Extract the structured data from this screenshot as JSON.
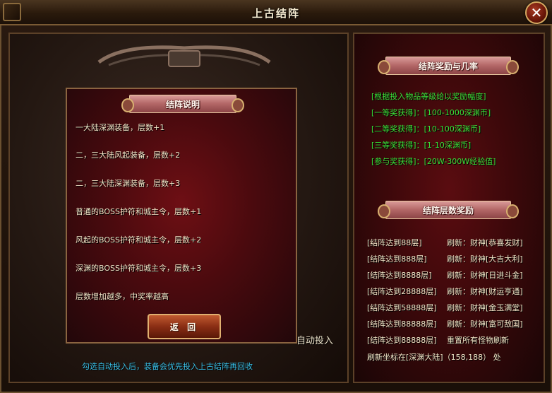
{
  "window": {
    "title": "上古结阵"
  },
  "left": {
    "explain_title": "结阵说明",
    "rules": [
      "一大陆深渊装备，层数+1",
      "二，三大陆风起装备，层数+2",
      "二，三大陆深渊装备，层数+3",
      "普通的BOSS护符和城主令，层数+1",
      "风起的BOSS护符和城主令，层数+2",
      "深渊的BOSS护符和城主令，层数+3",
      "层数增加越多，中奖率越高"
    ],
    "back_label": "返 回",
    "auto_label": "自动投入",
    "hint": "勾选自动投入后，装备会优先投入上古结阵再回收"
  },
  "right": {
    "reward_title": "结阵奖励与几率",
    "reward_lines": [
      "[根据投入物品等级给以奖励幅度]",
      "[一等奖获得]：[100-1000深渊币]",
      "[二等奖获得]：[10-100深渊币]",
      "[三等奖获得]：[1-10深渊币]",
      "[参与奖获得]：[20W-300W经验值]"
    ],
    "floor_title": "结阵层数奖励",
    "floors": [
      {
        "cond": "[结阵达到88层]",
        "reward": "刷新：财神[恭喜发财]"
      },
      {
        "cond": "[结阵达到888层]",
        "reward": "刷新：财神[大吉大利]"
      },
      {
        "cond": "[结阵达到8888层]",
        "reward": "刷新：财神[日进斗金]"
      },
      {
        "cond": "[结阵达到28888层]",
        "reward": "刷新：财神[财运亨通]"
      },
      {
        "cond": "[结阵达到58888层]",
        "reward": "刷新：财神[金玉满堂]"
      },
      {
        "cond": "[结阵达到88888层]",
        "reward": "刷新：财神[富可敌国]"
      },
      {
        "cond": "[结阵达到88888层]",
        "reward": "重置所有怪物刷新"
      }
    ],
    "coord_text": "刷新坐标在[深渊大陆]（158,188） 处"
  },
  "colors": {
    "green_text": "#38e038",
    "hint_text": "#38c0e8",
    "body_text": "#f0e6c8",
    "accent_red": "#6e0f14"
  }
}
